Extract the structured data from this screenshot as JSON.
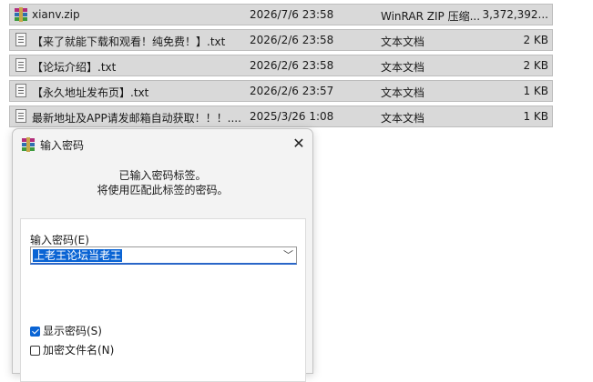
{
  "files": [
    {
      "icon": "winrar-archive-icon",
      "name": "xianv.zip",
      "date": "2026/7/6 23:58",
      "type": "WinRAR ZIP 压缩...",
      "size": "3,372,392..."
    },
    {
      "icon": "text-document-icon",
      "name": "【来了就能下载和观看！纯免费！】.txt",
      "date": "2026/2/6 23:58",
      "type": "文本文档",
      "size": "2 KB"
    },
    {
      "icon": "text-document-icon",
      "name": "【论坛介绍】.txt",
      "date": "2026/2/6 23:58",
      "type": "文本文档",
      "size": "2 KB"
    },
    {
      "icon": "text-document-icon",
      "name": "【永久地址发布页】.txt",
      "date": "2026/2/6 23:57",
      "type": "文本文档",
      "size": "1 KB"
    },
    {
      "icon": "text-document-icon",
      "name": "最新地址及APP请发邮箱自动获取！！！....",
      "date": "2025/3/26 1:08",
      "type": "文本文档",
      "size": "1 KB"
    }
  ],
  "dialog": {
    "title": "输入密码",
    "close_icon": "close-icon",
    "message_line1": "已输入密码标签。",
    "message_line2": "将使用匹配此标签的密码。",
    "password_label": "输入密码(E)",
    "password_value": "上老王论坛当老王",
    "show_password_label": "显示密码(S)",
    "show_password_checked": true,
    "encrypt_filenames_label": "加密文件名(N)",
    "encrypt_filenames_checked": false
  },
  "colors": {
    "row_bg": "#d9d9d9",
    "selection": "#0a64d4",
    "dialog_bg": "#f3f3f3"
  }
}
